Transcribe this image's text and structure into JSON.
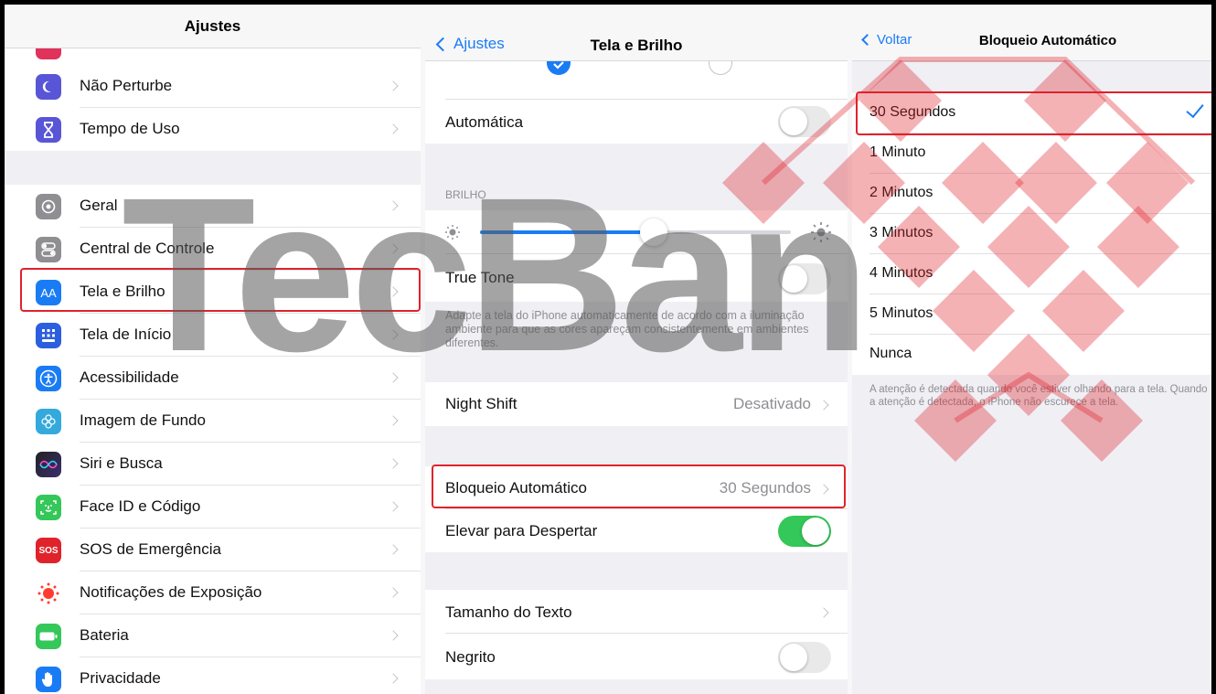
{
  "panel_settings": {
    "title": "Ajustes",
    "items": [
      {
        "label": "Não Perturbe",
        "icon": "moon-icon",
        "color": "#5856d6"
      },
      {
        "label": "Tempo de Uso",
        "icon": "hourglass-icon",
        "color": "#5856d6"
      },
      {
        "label": "Geral",
        "icon": "gear-icon",
        "color": "#8e8e93"
      },
      {
        "label": "Central de Controle",
        "icon": "switches-icon",
        "color": "#8e8e93"
      },
      {
        "label": "Tela e Brilho",
        "icon": "display-brightness-icon",
        "color": "#1a7cf5"
      },
      {
        "label": "Tela de Início",
        "icon": "home-screen-icon",
        "color": "#2c5fe0"
      },
      {
        "label": "Acessibilidade",
        "icon": "accessibility-icon",
        "color": "#1a7cf5"
      },
      {
        "label": "Imagem de Fundo",
        "icon": "wallpaper-icon",
        "color": "#34aadc"
      },
      {
        "label": "Siri e Busca",
        "icon": "siri-icon",
        "color": "#222222"
      },
      {
        "label": "Face ID e Código",
        "icon": "face-id-icon",
        "color": "#34c759"
      },
      {
        "label": "SOS de Emergência",
        "icon": "sos-icon",
        "color": "#e0232b"
      },
      {
        "label": "Notificações de Exposição",
        "icon": "exposure-icon",
        "color": "#ffffff"
      },
      {
        "label": "Bateria",
        "icon": "battery-icon",
        "color": "#34c759"
      },
      {
        "label": "Privacidade",
        "icon": "hand-icon",
        "color": "#1a7cf5"
      }
    ],
    "sos_text": "SOS",
    "aa_text": "AA"
  },
  "panel_display": {
    "back_label": "Ajustes",
    "title": "Tela e Brilho",
    "automatica": "Automática",
    "brilho_header": "BRILHO",
    "true_tone": "True Tone",
    "true_tone_desc": "Adapte a tela do iPhone automaticamente de acordo com a iluminação ambiente para que as cores apareçam consistentemente em ambientes diferentes.",
    "night_shift": "Night Shift",
    "night_shift_value": "Desativado",
    "auto_lock": "Bloqueio Automático",
    "auto_lock_value": "30 Segundos",
    "raise_to_wake": "Elevar para Despertar",
    "text_size": "Tamanho do Texto",
    "bold": "Negrito",
    "brightness": 0.56
  },
  "panel_autolock": {
    "back_label": "Voltar",
    "title": "Bloqueio Automático",
    "options": [
      "30 Segundos",
      "1 Minuto",
      "2 Minutos",
      "3 Minutos",
      "4 Minutos",
      "5 Minutos",
      "Nunca"
    ],
    "selected": "30 Segundos",
    "footer": "A atenção é detectada quando você estiver olhando para a tela. Quando a atenção é detectada, o iPhone não escurece a tela."
  },
  "watermark": {
    "text": "TecBan",
    "color": "#e0232b"
  }
}
